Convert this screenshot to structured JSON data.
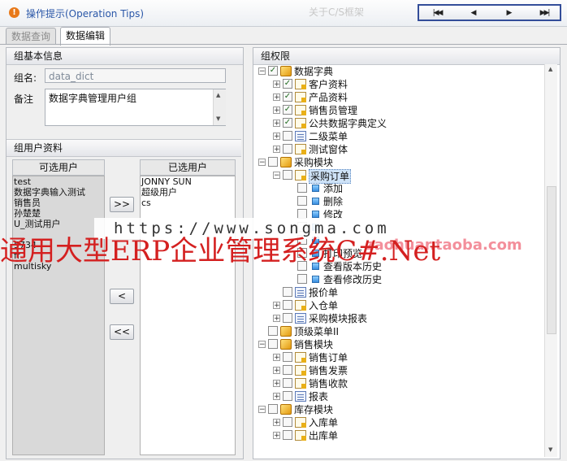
{
  "header": {
    "tip_icon": "!",
    "tip_text": "操作提示(Operation Tips)",
    "faint_title": "关于C/S框架",
    "nav": [
      "first",
      "prev",
      "next",
      "last"
    ]
  },
  "tabs": [
    {
      "label": "数据查询",
      "active": false
    },
    {
      "label": "数据编辑",
      "active": true
    }
  ],
  "basic": {
    "section_title": "组基本信息",
    "name_label": "组名:",
    "name_value": "data_dict",
    "remark_label": "备注",
    "remark_value": "数据字典管理用户组"
  },
  "users": {
    "section_title": "组用户资料",
    "available_header": "可选用户",
    "available": [
      "test",
      "数据字典输入测试",
      "销售员",
      "孙楚楚",
      "U_测试用户",
      "",
      "5734",
      "ff",
      "multisky"
    ],
    "selected_header": "已选用户",
    "selected": [
      "JONNY SUN",
      "超级用户",
      "cs"
    ],
    "add_label": ">>",
    "remove_label": "<",
    "remove_all_label": "<<"
  },
  "permissions": {
    "section_title": "组权限",
    "rows": [
      {
        "label": "数据字典",
        "level": 0,
        "expander": "−",
        "checked": true,
        "icon": "cube"
      },
      {
        "label": "客户资料",
        "level": 1,
        "expander": "+",
        "checked": true,
        "icon": "doc"
      },
      {
        "label": "产品资料",
        "level": 1,
        "expander": "+",
        "checked": true,
        "icon": "doc"
      },
      {
        "label": "销售员管理",
        "level": 1,
        "expander": "+",
        "checked": true,
        "icon": "doc"
      },
      {
        "label": "公共数据字典定义",
        "level": 1,
        "expander": "+",
        "checked": true,
        "icon": "doc"
      },
      {
        "label": "二级菜单",
        "level": 1,
        "expander": "+",
        "checked": false,
        "icon": "form"
      },
      {
        "label": "测试窗体",
        "level": 1,
        "expander": "+",
        "checked": false,
        "icon": "doc"
      },
      {
        "label": "采购模块",
        "level": 0,
        "expander": "−",
        "checked": false,
        "icon": "cube"
      },
      {
        "label": "采购订单",
        "level": 1,
        "expander": "−",
        "checked": false,
        "icon": "doc",
        "selected": true
      },
      {
        "label": "添加",
        "level": 2,
        "expander": "",
        "checked": false,
        "icon": "sq"
      },
      {
        "label": "删除",
        "level": 2,
        "expander": "",
        "checked": false,
        "icon": "sq"
      },
      {
        "label": "修改",
        "level": 2,
        "expander": "",
        "checked": false,
        "icon": "sq"
      },
      {
        "label": "",
        "level": 2,
        "expander": "",
        "checked": false,
        "icon": "sq"
      },
      {
        "label": "",
        "level": 2,
        "expander": "",
        "checked": false,
        "icon": "sq"
      },
      {
        "label": "打印预览",
        "level": 2,
        "expander": "",
        "checked": false,
        "icon": "sq"
      },
      {
        "label": "查看版本历史",
        "level": 2,
        "expander": "",
        "checked": false,
        "icon": "sq"
      },
      {
        "label": "查看修改历史",
        "level": 2,
        "expander": "",
        "checked": false,
        "icon": "sq"
      },
      {
        "label": "报价单",
        "level": 1,
        "expander": "",
        "checked": false,
        "icon": "form"
      },
      {
        "label": "入仓单",
        "level": 1,
        "expander": "+",
        "checked": false,
        "icon": "doc"
      },
      {
        "label": "采购模块报表",
        "level": 1,
        "expander": "+",
        "checked": false,
        "icon": "form"
      },
      {
        "label": "顶级菜单II",
        "level": 0,
        "expander": "",
        "checked": false,
        "icon": "cube"
      },
      {
        "label": "销售模块",
        "level": 0,
        "expander": "−",
        "checked": false,
        "icon": "cube"
      },
      {
        "label": "销售订单",
        "level": 1,
        "expander": "+",
        "checked": false,
        "icon": "doc"
      },
      {
        "label": "销售发票",
        "level": 1,
        "expander": "+",
        "checked": false,
        "icon": "doc"
      },
      {
        "label": "销售收款",
        "level": 1,
        "expander": "+",
        "checked": false,
        "icon": "doc"
      },
      {
        "label": "报表",
        "level": 1,
        "expander": "+",
        "checked": false,
        "icon": "form"
      },
      {
        "label": "库存模块",
        "level": 0,
        "expander": "−",
        "checked": false,
        "icon": "cube"
      },
      {
        "label": "入库单",
        "level": 1,
        "expander": "+",
        "checked": false,
        "icon": "doc"
      },
      {
        "label": "出库单",
        "level": 1,
        "expander": "+",
        "checked": false,
        "icon": "doc"
      }
    ]
  },
  "watermark": {
    "url": "https://www.songma.com",
    "title": "通用大型ERP企业管理系统C#.Net",
    "shop": "zaohuar.taoba.com"
  }
}
